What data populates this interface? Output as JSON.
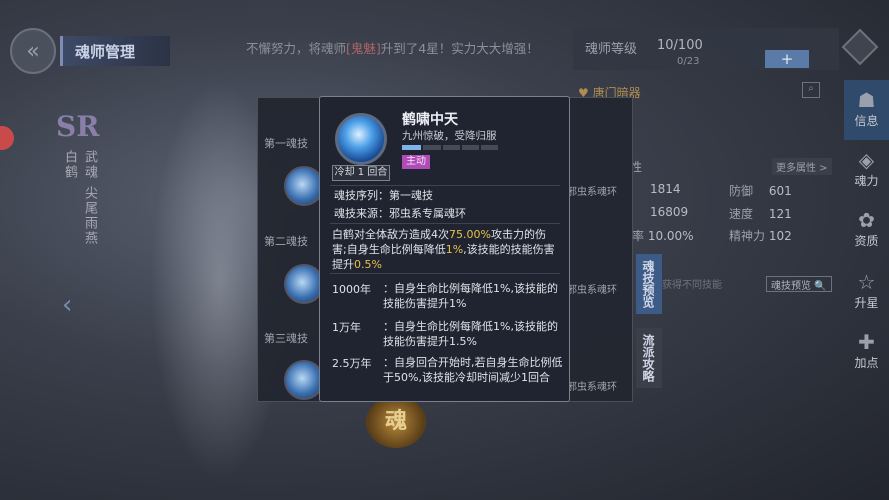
{
  "header": {
    "back_icon": "double-chevron-icon",
    "title": "魂师管理",
    "notice_prefix": "不懈努力，将魂师",
    "notice_name": "[鬼魅]",
    "notice_suffix": "升到了4星！实力大大增强！",
    "level_label": "魂师等级",
    "level_value": "10/100",
    "level_sub": "0/23",
    "plus_label": "+"
  },
  "character": {
    "rarity": "SR",
    "name": "白鹤",
    "title": "武魂",
    "spirit": "尖尾雨燕"
  },
  "stats": {
    "tower": "唐门暗器",
    "more_attr": "更多属性 >",
    "ring_type": "邪虫系魂环",
    "values": {
      "hp": "1814",
      "atk": "16809",
      "crit": "10.00%",
      "def_label": "防御",
      "def": "601",
      "spd_label": "速度",
      "spd": "121",
      "mental_label": "精神力",
      "mental": "102"
    }
  },
  "skills": {
    "rows": [
      {
        "label": "第一魂技",
        "ring": "邪虫系魂环"
      },
      {
        "label": "第二魂技",
        "ring": "邪虫系魂环"
      },
      {
        "label": "第三魂技",
        "ring": "邪虫系魂环"
      }
    ],
    "tab_active": "魂技预览",
    "tab_inactive": "流派攻略",
    "filter_placeholder": "获得不同技能",
    "preview_btn": "魂技预览 🔍",
    "emblem": "魂"
  },
  "side_tabs": [
    {
      "label": "信息",
      "icon": "info-icon"
    },
    {
      "label": "魂力",
      "icon": "soul-power-icon"
    },
    {
      "label": "资质",
      "icon": "aptitude-icon"
    },
    {
      "label": "升星",
      "icon": "star-icon"
    },
    {
      "label": "加点",
      "icon": "add-point-icon"
    }
  ],
  "tooltip": {
    "cooldown": "冷却 1 回合",
    "name": "鹤啸中天",
    "subtitle": "九州惊破，受降归服",
    "tag": "主动",
    "bar_fill": 0.2,
    "seq_label": "魂技序列：",
    "seq_value": "第一魂技",
    "source_label": "魂技来源：",
    "source_value": "邪虫系专属魂环",
    "desc_a": "白鹤对全体敌方造成4次",
    "desc_pct1": "75.00%",
    "desc_b": "攻击力的伤害;自身生命比例每降低",
    "desc_pct2": "1%",
    "desc_c": ",该技能的技能伤害提升",
    "desc_pct3": "0.5%",
    "years": [
      {
        "year": "1000年",
        "text": "：自身生命比例每降低1%,该技能的技能伤害提升1%"
      },
      {
        "year": "1万年",
        "text": "：自身生命比例每降低1%,该技能的技能伤害提升1.5%"
      },
      {
        "year": "2.5万年",
        "text": "：自身回合开始时,若自身生命比例低于50%,该技能冷却时间减少1回合"
      }
    ]
  }
}
